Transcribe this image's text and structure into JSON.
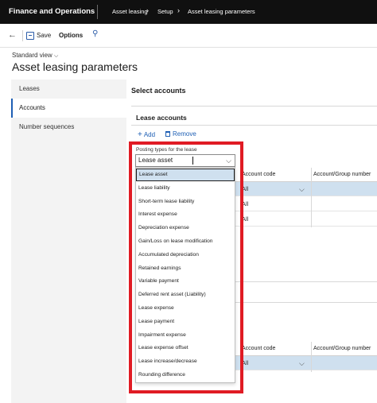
{
  "topbar": {
    "app_title": "Finance and Operations",
    "breadcrumbs": [
      "Asset leasing",
      "Setup",
      "Asset leasing parameters"
    ]
  },
  "actionpane": {
    "save_label": "Save",
    "options_label": "Options"
  },
  "page": {
    "view_name": "Standard view",
    "title": "Asset leasing parameters"
  },
  "sidebar": {
    "items": [
      {
        "label": "Leases",
        "active": false
      },
      {
        "label": "Accounts",
        "active": true
      },
      {
        "label": "Number sequences",
        "active": false
      }
    ]
  },
  "main": {
    "section_title": "Select accounts",
    "sub_title": "Lease accounts",
    "add_label": "Add",
    "remove_label": "Remove",
    "field_label": "Posting types for the lease",
    "field_value": "Lease asset"
  },
  "grid_top": {
    "headers": [
      "Account code",
      "Account/Group number"
    ],
    "rows": [
      {
        "account_code": "All",
        "selected": true
      },
      {
        "account_code": "All",
        "selected": false
      },
      {
        "account_code": "All",
        "selected": false
      }
    ]
  },
  "grid_bottom": {
    "headers": [
      "Account code",
      "Account/Group number"
    ],
    "rows": [
      {
        "account_code": "All",
        "selected": true
      }
    ]
  },
  "dropdown": {
    "options": [
      "Lease asset",
      "Lease liability",
      "Short-term lease liability",
      "Interest expense",
      "Depreciation expense",
      "Gain/Loss on lease modification",
      "Accumulated depreciation",
      "Retained earnings",
      "Variable payment",
      "Deferred rent asset (Liability)",
      "Lease expense",
      "Lease payment",
      "Impairment expense",
      "Lease expense offset",
      "Lease increase/decrease",
      "Rounding difference"
    ],
    "selected_index": 0
  },
  "colors": {
    "topbar": "#101010",
    "accent": "#1e5fb4",
    "highlight_frame": "#e01b24",
    "selection": "#cfe0ef"
  }
}
